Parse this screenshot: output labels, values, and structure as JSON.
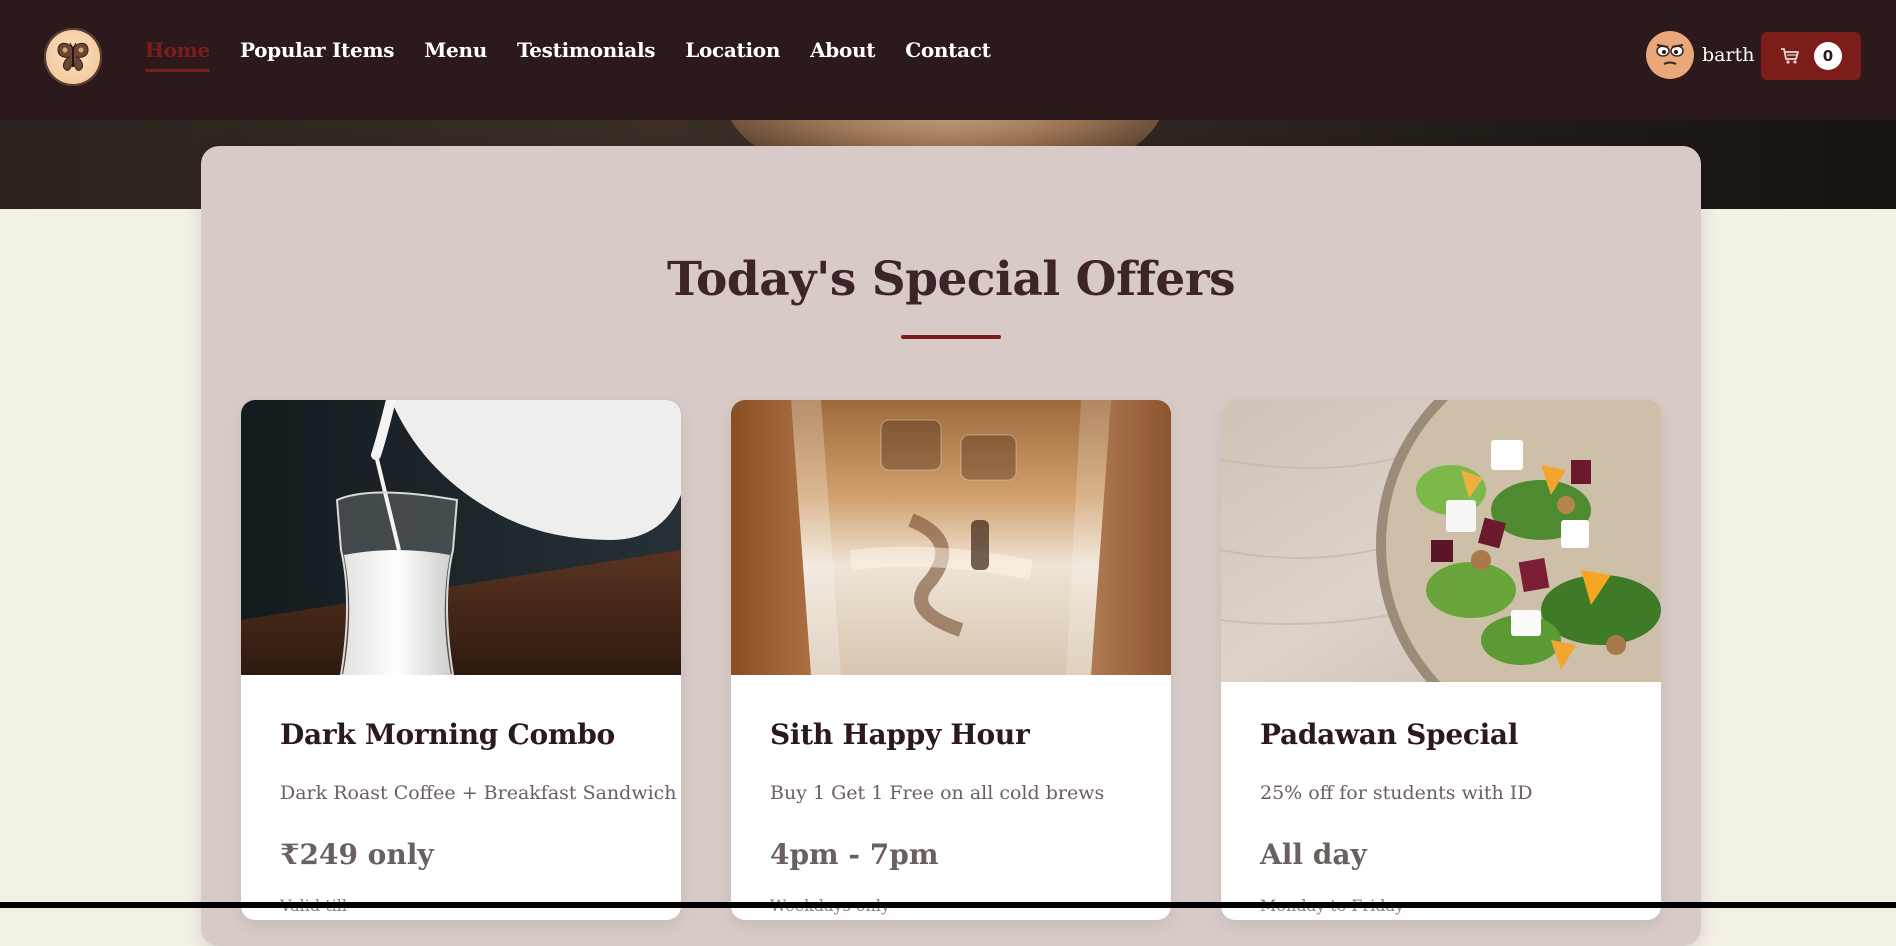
{
  "nav": {
    "logo_icon": "butterfly-icon",
    "links": [
      {
        "label": "Home",
        "active": true
      },
      {
        "label": "Popular Items"
      },
      {
        "label": "Menu"
      },
      {
        "label": "Testimonials"
      },
      {
        "label": "Location"
      },
      {
        "label": "About"
      },
      {
        "label": "Contact"
      }
    ],
    "user": {
      "name": "barth",
      "avatar_icon": "cartoon-face-avatar"
    },
    "cart": {
      "icon": "cart-icon",
      "count": "0"
    }
  },
  "offers": {
    "title": "Today's Special Offers",
    "cards": [
      {
        "image": "milk-pouring-photo",
        "title": "Dark Morning Combo",
        "description": "Dark Roast Coffee + Breakfast Sandwich",
        "price": "₹249 only",
        "note": "Valid till"
      },
      {
        "image": "iced-coffee-photo",
        "title": "Sith Happy Hour",
        "description": "Buy 1 Get 1 Free on all cold brews",
        "price": "4pm - 7pm",
        "note": "Weekdays only"
      },
      {
        "image": "salad-bowl-photo",
        "title": "Padawan Special",
        "description": "25% off for students with ID",
        "price": "All day",
        "note": "Monday to Friday"
      }
    ]
  },
  "colors": {
    "header_bg": "#2c191c",
    "accent": "#7d1d1a",
    "panel_bg": "#d8cbc7",
    "page_bg": "#f4f0e6",
    "title": "#3d2427"
  }
}
